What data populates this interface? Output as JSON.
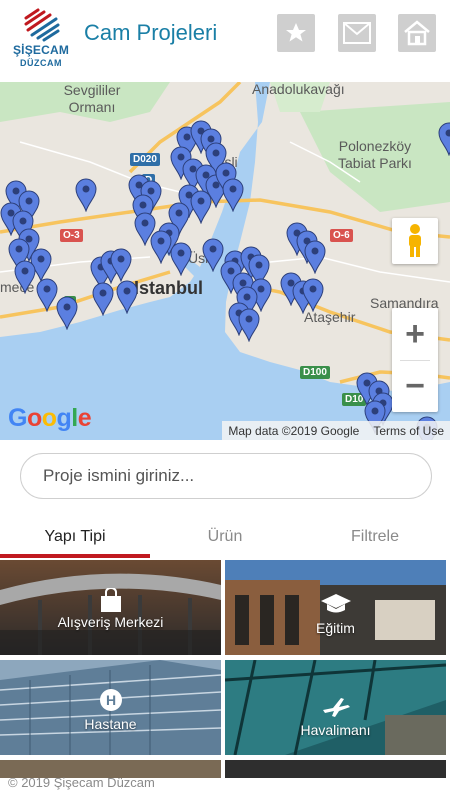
{
  "header": {
    "logo_line1": "ŞİŞECAM",
    "logo_line2": "DÜZCAM",
    "title": "Cam Projeleri",
    "buttons": [
      "star-icon",
      "mail-icon",
      "home-icon"
    ]
  },
  "map": {
    "labels": {
      "sevgililer": "Sevgililer\nOrmanı",
      "anadolu": "Anadolukavağı",
      "polonez": "Polonezköy\nTabiat Parkı",
      "istanbul": "Istanbul",
      "atasehir": "Ataşehir",
      "samandira": "Samandıra",
      "usk": "Üsk",
      "sisli": "Şişli",
      "mece": "mece"
    },
    "road_badges": {
      "d020": "D020",
      "o3": "O-3",
      "o6": "O-6",
      "d100": "D100",
      "d10": "D10",
      "e5": "5",
      "b1": "D"
    },
    "google": "Google",
    "map_data": "Map data ©2019 Google",
    "terms": "Terms of Use",
    "zoom_in": "+",
    "zoom_out": "−",
    "colors": {
      "pin": "#5b7fe0",
      "water": "#a9cff2",
      "land": "#eae6df"
    }
  },
  "search": {
    "placeholder": "Proje ismini giriniz..."
  },
  "tabs": [
    {
      "label": "Yapı Tipi",
      "active": true
    },
    {
      "label": "Ürün",
      "active": false
    },
    {
      "label": "Filtrele",
      "active": false
    }
  ],
  "categories": [
    {
      "label": "Alışveriş Merkezi",
      "icon": "shopping-bag-icon"
    },
    {
      "label": "Eğitim",
      "icon": "graduation-cap-icon"
    },
    {
      "label": "Hastane",
      "icon": "hospital-icon"
    },
    {
      "label": "Havalimanı",
      "icon": "airplane-icon"
    }
  ],
  "footer": {
    "copyright": "© 2019 Şişecam Düzcam"
  },
  "accent": "#c0191f",
  "brand": "#1a7fa6"
}
